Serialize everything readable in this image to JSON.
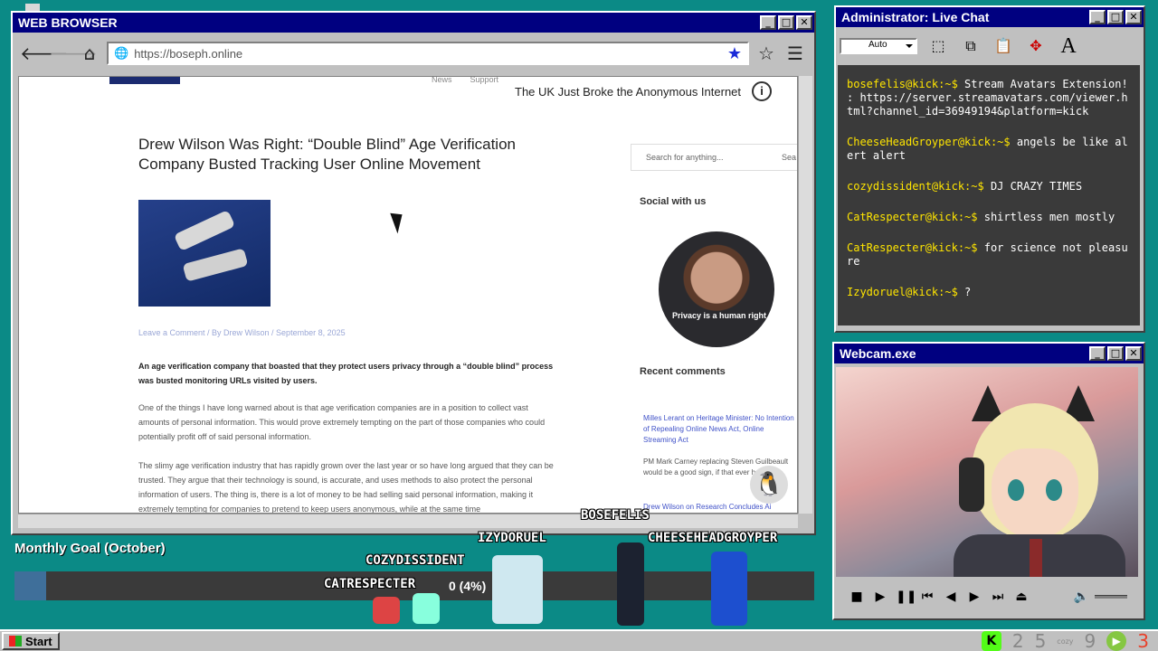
{
  "browser": {
    "title": "WEB BROWSER",
    "url": "https://boseph.online",
    "banner": "The UK Just Broke the Anonymous Internet",
    "topnav": [
      "News",
      "Support"
    ],
    "article": {
      "title": "Drew Wilson Was Right: “Double Blind” Age Verification Company Busted Tracking User Online Movement",
      "meta": "Leave a Comment / By Drew Wilson / September 8, 2025",
      "p1": "An age verification company that boasted that they protect users privacy through a “double blind” process was busted monitoring URLs visited by users.",
      "p2": "One of the things I have long warned about is that age verification companies are in a position to collect vast amounts of personal information. This would prove extremely tempting on the part of those companies who could potentially profit off of said personal information.",
      "p3": "The slimy age verification industry that has rapidly grown over the last year or so have long argued that they can be trusted. They argue that their technology is sound, is accurate, and uses methods to also protect the personal information of users. The thing is, there is a lot of money to be had selling said personal information, making it extremely tempting for companies to pretend to keep users anonymous, while at the same time"
    },
    "sidebar": {
      "search_placeholder": "Search for anything...",
      "search_button": "Sea",
      "social_heading": "Social with us",
      "recent_heading": "Recent comments",
      "comment1": "Milles Lerant on Heritage Minister: No Intention of Repealing Online News Act, Online Streaming Act",
      "comment2": "PM Mark Carney replacing Steven Guilbeault would be a good sign, if that ever happens.",
      "comment3": "Drew Wilson on Research Concludes Ai"
    },
    "facecam_shirt": "Privacy is a human right"
  },
  "chat": {
    "title": "Administrator: Live Chat",
    "font_size_select": "Auto",
    "messages": [
      {
        "user": "bosefelis@kick:~$",
        "text": " Stream Avatars Extension! : https://server.streamavatars.com/viewer.html?channel_id=36949194&platform=kick"
      },
      {
        "user": "CheeseHeadGroyper@kick:~$",
        "text": " angels be like alert alert"
      },
      {
        "user": "cozydissident@kick:~$",
        "text": " DJ CRAZY TIMES"
      },
      {
        "user": "CatRespecter@kick:~$",
        "text": " shirtless men mostly"
      },
      {
        "user": "CatRespecter@kick:~$",
        "text": " for science not pleasure"
      },
      {
        "user": "Izydoruel@kick:~$",
        "text": " ?"
      }
    ]
  },
  "webcam": {
    "title": "Webcam.exe"
  },
  "overlay": {
    "goal_title": "Monthly Goal (October)",
    "goal_text": "0 (4%)",
    "goal_fraction": 0.04,
    "names": [
      "BOSEFELIS",
      "IZYDORUEL",
      "CHEESEHEADGROYPER",
      "COZYDISSIDENT",
      "CATRESPECTER"
    ]
  },
  "taskbar": {
    "start": "Start",
    "tray": [
      "2",
      "5",
      "9",
      "3"
    ]
  },
  "colors": {
    "desktop": "#0b8a86",
    "titlebar": "#000080",
    "chat_user": "#ffe500",
    "kick_green": "#53fc18"
  }
}
